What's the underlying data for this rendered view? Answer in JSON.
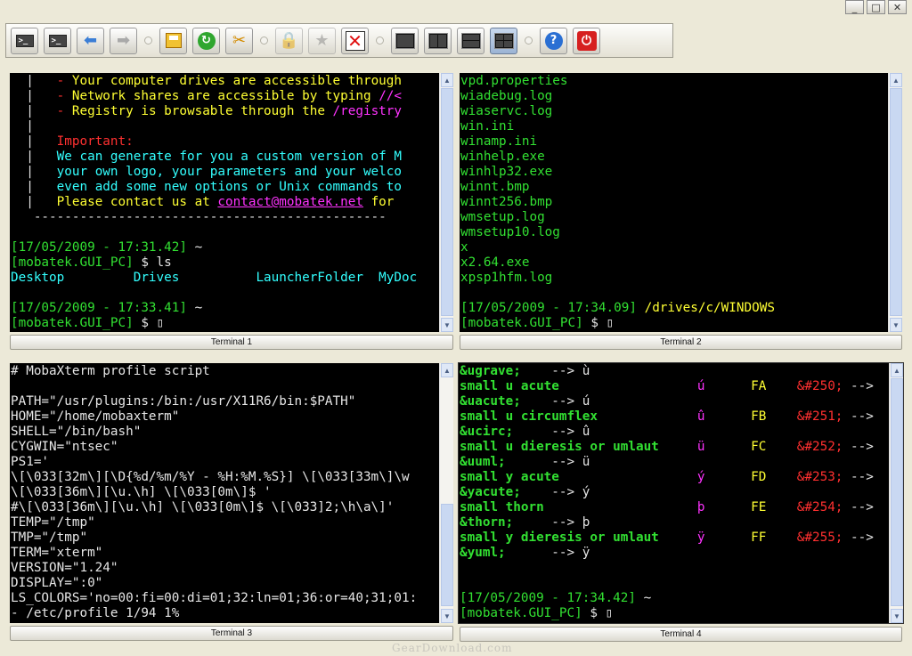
{
  "window": {
    "buttons": [
      "_",
      "□",
      "✕"
    ]
  },
  "toolbar": {
    "items": [
      {
        "name": "new-terminal-button",
        "kind": "term",
        "label": ">_"
      },
      {
        "name": "new-terminal-2-button",
        "kind": "term",
        "label": ">_"
      },
      {
        "name": "previous-tab-button",
        "kind": "arrow",
        "label": "⬅"
      },
      {
        "name": "next-tab-button",
        "kind": "arrow-dis",
        "label": "➡"
      },
      {
        "sep": true
      },
      {
        "name": "save-session-button",
        "kind": "save"
      },
      {
        "name": "refresh-button",
        "kind": "refresh",
        "label": "↻"
      },
      {
        "name": "settings-button",
        "kind": "tools",
        "label": "✂"
      },
      {
        "sep": true
      },
      {
        "name": "lock-button",
        "kind": "grey",
        "label": "🔒",
        "disabled": true
      },
      {
        "name": "favorite-button",
        "kind": "grey",
        "label": "★",
        "disabled": true
      },
      {
        "name": "close-terminal-button",
        "kind": "x",
        "label": "✕"
      },
      {
        "sep": true
      },
      {
        "name": "layout-single-button",
        "kind": "layout1"
      },
      {
        "name": "layout-vertical-button",
        "kind": "layout2v"
      },
      {
        "name": "layout-horizontal-button",
        "kind": "layout2h"
      },
      {
        "name": "layout-quad-button",
        "kind": "layout4",
        "active": true
      },
      {
        "sep": true
      },
      {
        "name": "help-button",
        "kind": "help",
        "label": "?"
      },
      {
        "name": "exit-button",
        "kind": "power",
        "label": "⏻"
      }
    ]
  },
  "terminals": [
    {
      "label": "Terminal 1",
      "lines": [
        [
          [
            "c-w",
            "  |   "
          ],
          [
            "c-r",
            "- "
          ],
          [
            "c-y",
            "Your computer drives are accessible through "
          ]
        ],
        [
          [
            "c-w",
            "  |   "
          ],
          [
            "c-r",
            "- "
          ],
          [
            "c-y",
            "Network shares are accessible by typing "
          ],
          [
            "c-m",
            "//<"
          ]
        ],
        [
          [
            "c-w",
            "  |   "
          ],
          [
            "c-r",
            "- "
          ],
          [
            "c-y",
            "Registry is browsable through the "
          ],
          [
            "c-m",
            "/registry"
          ]
        ],
        [
          [
            "c-w",
            "  |"
          ]
        ],
        [
          [
            "c-w",
            "  |   "
          ],
          [
            "c-r",
            "Important:"
          ]
        ],
        [
          [
            "c-w",
            "  |   "
          ],
          [
            "c-c",
            "We can generate for you a custom version of M"
          ]
        ],
        [
          [
            "c-w",
            "  |   "
          ],
          [
            "c-c",
            "your own logo, your parameters and your welco"
          ]
        ],
        [
          [
            "c-w",
            "  |   "
          ],
          [
            "c-c",
            "even add some new options or Unix commands to"
          ]
        ],
        [
          [
            "c-w",
            "  |   "
          ],
          [
            "c-y",
            "Please contact us at "
          ],
          [
            "c-m c-ul",
            "contact@mobatek.net"
          ],
          [
            "c-y",
            " for"
          ]
        ],
        [
          [
            "c-w",
            "   ----------------------------------------------"
          ]
        ],
        [
          [
            "c-w",
            ""
          ]
        ],
        [
          [
            "c-g",
            "[17/05/2009 - 17:31.42] "
          ],
          [
            "c-w",
            "~"
          ]
        ],
        [
          [
            "c-g",
            "[mobatek.GUI_PC] "
          ],
          [
            "c-w",
            "$ ls"
          ]
        ],
        [
          [
            "c-c",
            "Desktop         Drives          LauncherFolder  MyDoc"
          ]
        ],
        [
          [
            "c-w",
            ""
          ]
        ],
        [
          [
            "c-g",
            "[17/05/2009 - 17:33.41] "
          ],
          [
            "c-w",
            "~"
          ]
        ],
        [
          [
            "c-g",
            "[mobatek.GUI_PC] "
          ],
          [
            "c-w",
            "$ ▯"
          ]
        ]
      ]
    },
    {
      "label": "Terminal 2",
      "lines": [
        [
          [
            "c-g",
            "vpd.properties"
          ]
        ],
        [
          [
            "c-g",
            "wiadebug.log"
          ]
        ],
        [
          [
            "c-g",
            "wiaservc.log"
          ]
        ],
        [
          [
            "c-g",
            "win.ini"
          ]
        ],
        [
          [
            "c-g",
            "winamp.ini"
          ]
        ],
        [
          [
            "c-g",
            "winhelp.exe"
          ]
        ],
        [
          [
            "c-g",
            "winhlp32.exe"
          ]
        ],
        [
          [
            "c-g",
            "winnt.bmp"
          ]
        ],
        [
          [
            "c-g",
            "winnt256.bmp"
          ]
        ],
        [
          [
            "c-g",
            "wmsetup.log"
          ]
        ],
        [
          [
            "c-g",
            "wmsetup10.log"
          ]
        ],
        [
          [
            "c-g",
            "x"
          ]
        ],
        [
          [
            "c-g",
            "x2.64.exe"
          ]
        ],
        [
          [
            "c-g",
            "xpsp1hfm.log"
          ]
        ],
        [
          [
            "c-w",
            ""
          ]
        ],
        [
          [
            "c-g",
            "[17/05/2009 - 17:34.09] "
          ],
          [
            "c-y",
            "/drives/c/WINDOWS"
          ]
        ],
        [
          [
            "c-g",
            "[mobatek.GUI_PC] "
          ],
          [
            "c-w",
            "$ ▯"
          ]
        ]
      ]
    },
    {
      "label": "Terminal 3",
      "lines": [
        [
          [
            "c-w",
            "# MobaXterm profile script"
          ]
        ],
        [
          [
            "c-w",
            ""
          ]
        ],
        [
          [
            "c-w",
            "PATH=\"/usr/plugins:/bin:/usr/X11R6/bin:$PATH\""
          ]
        ],
        [
          [
            "c-w",
            "HOME=\"/home/mobaxterm\""
          ]
        ],
        [
          [
            "c-w",
            "SHELL=\"/bin/bash\""
          ]
        ],
        [
          [
            "c-w",
            "CYGWIN=\"ntsec\""
          ]
        ],
        [
          [
            "c-w",
            "PS1='"
          ]
        ],
        [
          [
            "c-w",
            "\\[\\033[32m\\][\\D{%d/%m/%Y - %H:%M.%S}] \\[\\033[33m\\]\\w"
          ]
        ],
        [
          [
            "c-w",
            "\\[\\033[36m\\][\\u.\\h] \\[\\033[0m\\]$ '"
          ]
        ],
        [
          [
            "c-w",
            "#\\[\\033[36m\\][\\u.\\h] \\[\\033[0m\\]$ \\[\\033]2;\\h\\a\\]'"
          ]
        ],
        [
          [
            "c-w",
            "TEMP=\"/tmp\""
          ]
        ],
        [
          [
            "c-w",
            "TMP=\"/tmp\""
          ]
        ],
        [
          [
            "c-w",
            "TERM=\"xterm\""
          ]
        ],
        [
          [
            "c-w",
            "VERSION=\"1.24\""
          ]
        ],
        [
          [
            "c-w",
            "DISPLAY=\":0\""
          ]
        ],
        [
          [
            "c-w",
            "LS_COLORS='no=00:fi=00:di=01;32:ln=01;36:or=40;31;01:"
          ]
        ],
        [
          [
            "c-w",
            "- /etc/profile 1/94 1%"
          ]
        ]
      ]
    },
    {
      "label": "Terminal 4",
      "lines": [
        [
          [
            "c-gb",
            "&ugrave;"
          ],
          [
            "c-w",
            "    --> ù"
          ]
        ],
        [
          [
            "c-gb",
            "small u acute                  "
          ],
          [
            "c-m",
            "ú      "
          ],
          [
            "c-y",
            "FA    "
          ],
          [
            "c-r",
            "&#250;"
          ],
          [
            "c-w",
            " -->"
          ]
        ],
        [
          [
            "c-gb",
            "&uacute;"
          ],
          [
            "c-w",
            "    --> ú"
          ]
        ],
        [
          [
            "c-gb",
            "small u circumflex             "
          ],
          [
            "c-m",
            "û      "
          ],
          [
            "c-y",
            "FB    "
          ],
          [
            "c-r",
            "&#251;"
          ],
          [
            "c-w",
            " -->"
          ]
        ],
        [
          [
            "c-gb",
            "&ucirc;"
          ],
          [
            "c-w",
            "     --> û"
          ]
        ],
        [
          [
            "c-gb",
            "small u dieresis or umlaut     "
          ],
          [
            "c-m",
            "ü      "
          ],
          [
            "c-y",
            "FC    "
          ],
          [
            "c-r",
            "&#252;"
          ],
          [
            "c-w",
            " -->"
          ]
        ],
        [
          [
            "c-gb",
            "&uuml;"
          ],
          [
            "c-w",
            "      --> ü"
          ]
        ],
        [
          [
            "c-gb",
            "small y acute                  "
          ],
          [
            "c-m",
            "ý      "
          ],
          [
            "c-y",
            "FD    "
          ],
          [
            "c-r",
            "&#253;"
          ],
          [
            "c-w",
            " -->"
          ]
        ],
        [
          [
            "c-gb",
            "&yacute;"
          ],
          [
            "c-w",
            "    --> ý"
          ]
        ],
        [
          [
            "c-gb",
            "small thorn                    "
          ],
          [
            "c-m",
            "þ      "
          ],
          [
            "c-y",
            "FE    "
          ],
          [
            "c-r",
            "&#254;"
          ],
          [
            "c-w",
            " -->"
          ]
        ],
        [
          [
            "c-gb",
            "&thorn;"
          ],
          [
            "c-w",
            "     --> þ"
          ]
        ],
        [
          [
            "c-gb",
            "small y dieresis or umlaut     "
          ],
          [
            "c-m",
            "ÿ      "
          ],
          [
            "c-y",
            "FF    "
          ],
          [
            "c-r",
            "&#255;"
          ],
          [
            "c-w",
            " -->"
          ]
        ],
        [
          [
            "c-gb",
            "&yuml;"
          ],
          [
            "c-w",
            "      --> ÿ"
          ]
        ],
        [
          [
            "c-w",
            ""
          ]
        ],
        [
          [
            "c-w",
            ""
          ]
        ],
        [
          [
            "c-g",
            "[17/05/2009 - 17:34.42] "
          ],
          [
            "c-w",
            "~"
          ]
        ],
        [
          [
            "c-g",
            "[mobatek.GUI_PC] "
          ],
          [
            "c-w",
            "$ ▯"
          ]
        ]
      ]
    }
  ],
  "watermark": "GearDownload.com"
}
